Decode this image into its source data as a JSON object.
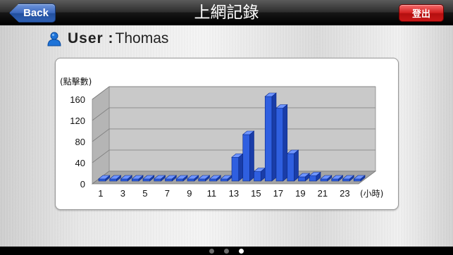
{
  "header": {
    "title": "上網記錄",
    "back_label": "Back",
    "logout_label": "登出"
  },
  "user": {
    "label": "User :",
    "name": "Thomas",
    "icon": "user-icon"
  },
  "chart_data": {
    "type": "bar",
    "ylabel": "(點擊數)",
    "xlabel": "(小時)",
    "ylim": [
      0,
      160
    ],
    "yticks": [
      0,
      40,
      80,
      120,
      160
    ],
    "xtick_labels": [
      "1",
      "3",
      "5",
      "7",
      "9",
      "11",
      "13",
      "15",
      "17",
      "19",
      "21",
      "23"
    ],
    "categories": [
      "1",
      "2",
      "3",
      "4",
      "5",
      "6",
      "7",
      "8",
      "9",
      "10",
      "11",
      "12",
      "13",
      "14",
      "15",
      "16",
      "17",
      "18",
      "19",
      "20",
      "21",
      "22",
      "23",
      "24"
    ],
    "values": [
      2,
      2,
      2,
      2,
      2,
      2,
      2,
      2,
      2,
      2,
      2,
      2,
      45,
      88,
      18,
      160,
      138,
      52,
      8,
      10,
      2,
      2,
      2,
      2
    ],
    "grid": true,
    "bar_color": "#2f5fe0"
  },
  "pager": {
    "pages": 3,
    "active": 3
  }
}
